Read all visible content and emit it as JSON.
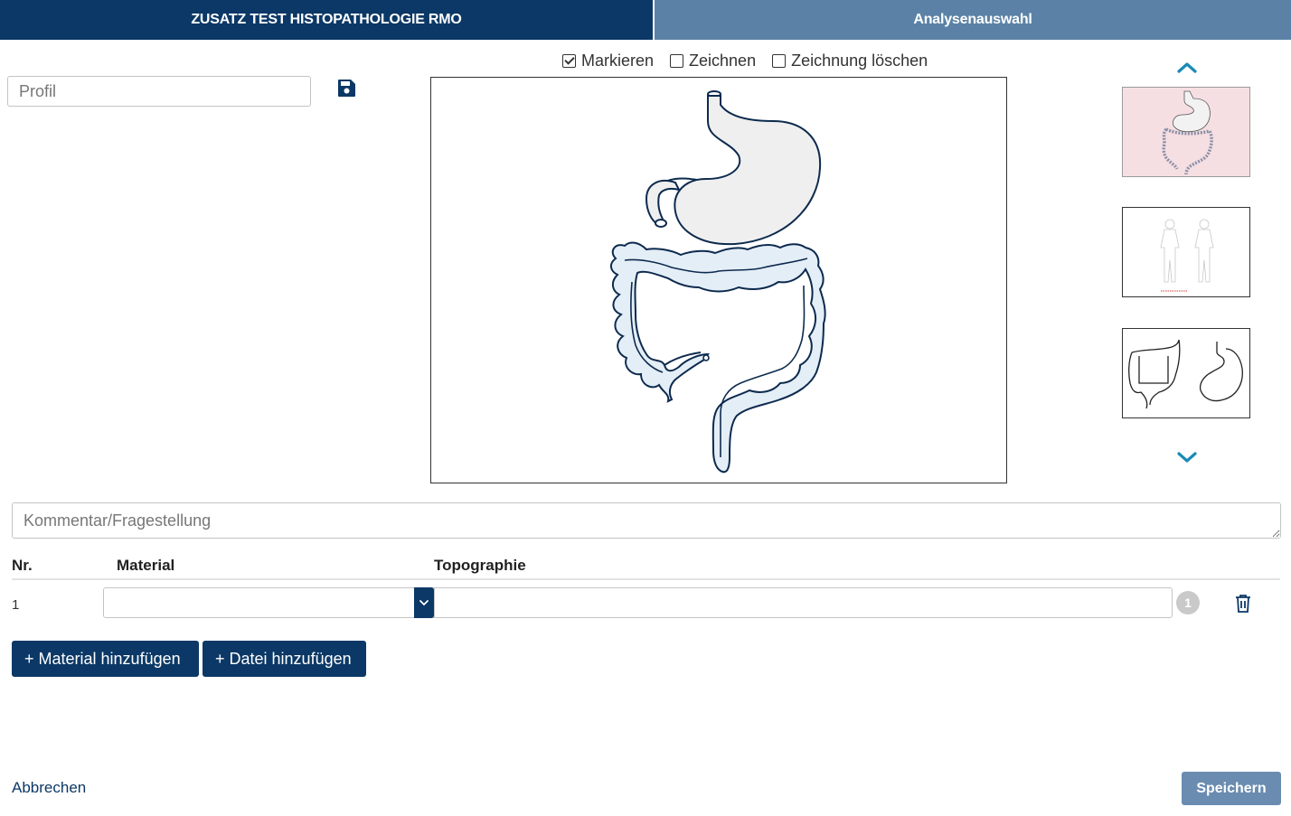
{
  "tabs": {
    "active_label": "ZUSATZ TEST HISTOPATHOLOGIE RMO",
    "inactive_label": "Analysenauswahl"
  },
  "profile": {
    "placeholder": "Profil"
  },
  "draw_options": [
    {
      "label": "Markieren",
      "checked": true
    },
    {
      "label": "Zeichnen",
      "checked": false
    },
    {
      "label": "Zeichnung löschen",
      "checked": false
    }
  ],
  "image_selection": {
    "thumbnails": [
      "digestive-tract-thumbnail",
      "body-front-back-thumbnail",
      "colon-stomach-outline-thumbnail"
    ],
    "selected_index": 0
  },
  "comment": {
    "placeholder": "Kommentar/Fragestellung"
  },
  "table": {
    "headers": {
      "nr": "Nr.",
      "material": "Material",
      "topography": "Topographie"
    },
    "rows": [
      {
        "nr": "1",
        "material": "",
        "topography": "",
        "count": "1"
      }
    ]
  },
  "actions": {
    "add_material": "+ Material hinzufügen",
    "add_file": "+ Datei hinzufügen",
    "cancel": "Abbrechen",
    "save": "Speichern"
  },
  "colors": {
    "primary": "#0b3866",
    "tab_inactive": "#5b82a6",
    "save_button": "#6a8cb0",
    "accent_arrow": "#1a8ab5",
    "organ_fill": "#e4eef7",
    "stomach_fill": "#efefef",
    "selected_thumb_bg": "#f6dfe2"
  }
}
